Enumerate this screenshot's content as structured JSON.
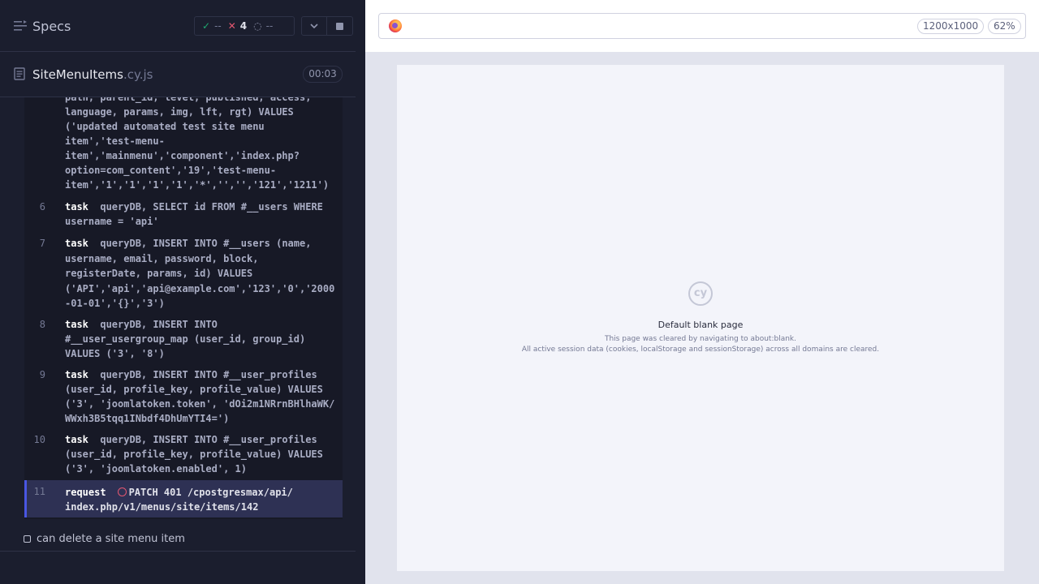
{
  "header": {
    "specs_label": "Specs",
    "stats": {
      "passed": "--",
      "failed": "4",
      "pending": "--"
    },
    "timer": "00:03"
  },
  "file": {
    "name": "SiteMenuItems",
    "ext": ".cy.js"
  },
  "log": [
    {
      "num": "",
      "kw": "",
      "text": "path, parent_id, level, published, access,\nlanguage, params, img, lft, rgt) VALUES\n('updated automated test site menu\nitem','test-menu-\nitem','mainmenu','component','index.php?\noption=com_content','19','test-menu-\nitem','1','1','1','1','*','','','121','1211')"
    },
    {
      "num": "6",
      "kw": "task",
      "text": "queryDB, SELECT id FROM #__users WHERE\nusername = 'api'"
    },
    {
      "num": "7",
      "kw": "task",
      "text": "queryDB, INSERT INTO #__users (name,\nusername, email, password, block,\nregisterDate, params, id) VALUES\n('API','api','api@example.com','123','0','2000\n-01-01','{}','3')"
    },
    {
      "num": "8",
      "kw": "task",
      "text": "queryDB, INSERT INTO\n#__user_usergroup_map (user_id, group_id)\nVALUES ('3', '8')"
    },
    {
      "num": "9",
      "kw": "task",
      "text": "queryDB, INSERT INTO #__user_profiles\n(user_id, profile_key, profile_value) VALUES\n('3', 'joomlatoken.token', 'dOi2m1NRrnBHlhaWK/\nWWxh3B5tqq1INbdf4DhUmYTI4=')"
    },
    {
      "num": "10",
      "kw": "task",
      "text": "queryDB, INSERT INTO #__user_profiles\n(user_id, profile_key, profile_value) VALUES\n('3', 'joomlatoken.enabled', 1)"
    },
    {
      "num": "11",
      "kw": "request",
      "text": "PATCH 401 /cpostgresmax/api/\nindex.php/v1/menus/site/items/142"
    }
  ],
  "next_test": "can delete a site menu item",
  "browser": {
    "viewport_size": "1200x1000",
    "zoom": "62%"
  },
  "blank_page": {
    "title": "Default blank page",
    "line1": "This page was cleared by navigating to about:blank.",
    "line2": "All active session data (cookies, localStorage and sessionStorage) across all domains are cleared.",
    "logo": "cy"
  }
}
